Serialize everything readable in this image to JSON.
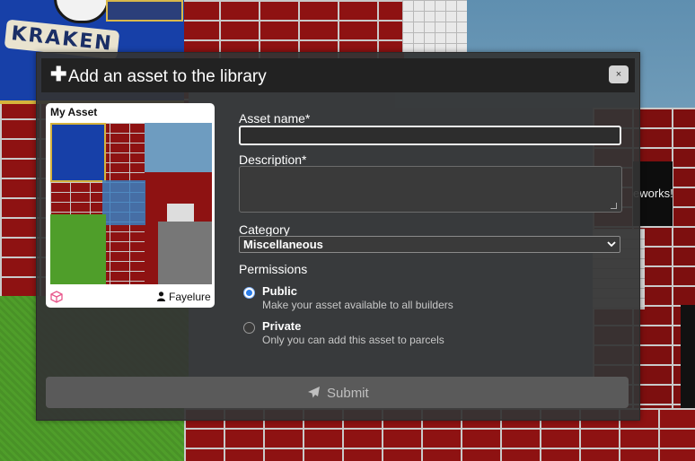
{
  "background": {
    "banner_text": "KRAKEN",
    "sign_text": "eworks!"
  },
  "modal": {
    "title": "Add an asset to the library",
    "close_label": "×",
    "preview": {
      "name": "My Asset",
      "author": "Fayelure"
    },
    "form": {
      "asset_name_label": "Asset name*",
      "asset_name_value": "",
      "description_label": "Description*",
      "description_value": "",
      "category_label": "Category",
      "category_selected": "Miscellaneous",
      "permissions_label": "Permissions",
      "options": [
        {
          "title": "Public",
          "description": "Make your asset available to all builders",
          "checked": true
        },
        {
          "title": "Private",
          "description": "Only you can add this asset to parcels",
          "checked": false
        }
      ]
    },
    "submit_label": "Submit"
  },
  "colors": {
    "accent": "#2b7de9",
    "modal_bg": "#343434",
    "header_bg": "#222222",
    "submit_bg": "#5a5a5a"
  },
  "icons": {
    "header": "plus-icon",
    "close": "close-icon",
    "asset_type": "cube-icon",
    "author": "user-icon",
    "submit": "send-icon",
    "select": "chevron-down-icon"
  }
}
